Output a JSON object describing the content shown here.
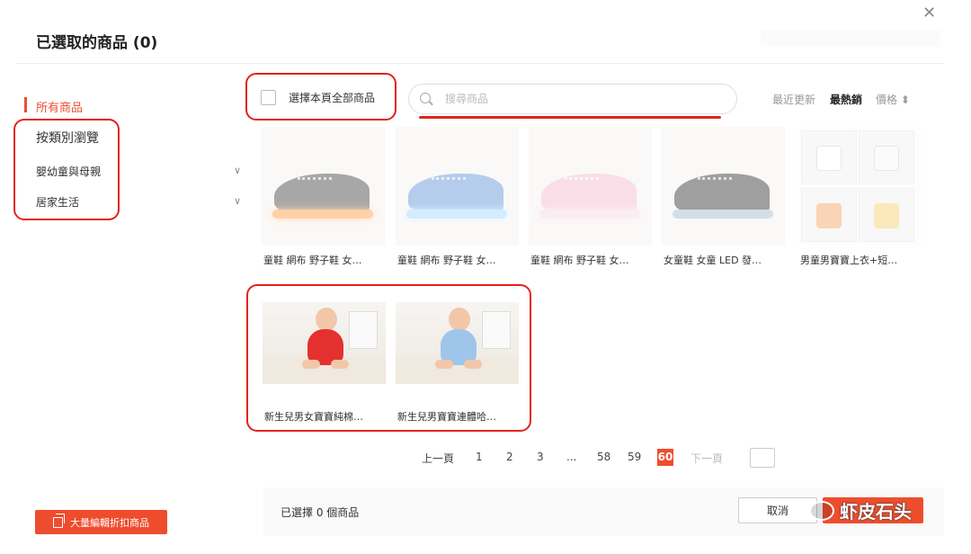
{
  "header": {
    "title": "已選取的商品 (0)",
    "close_icon": "close-icon"
  },
  "sidebar": {
    "items": [
      {
        "label": "所有商品",
        "active": true
      },
      {
        "label": "按類別瀏覽"
      },
      {
        "label": "嬰幼童與母親",
        "expandable": true
      },
      {
        "label": "居家生活",
        "expandable": true
      }
    ]
  },
  "toolbar": {
    "select_all_label": "選擇本頁全部商品",
    "search_placeholder": "搜尋商品",
    "search_value": "",
    "sort": {
      "recent": "最近更新",
      "hot": "最熱銷",
      "price": "價格 ⬍"
    }
  },
  "products": [
    {
      "name": "童鞋 網布 野子鞋 女…",
      "image": "orange-light-sneakers"
    },
    {
      "name": "童鞋 網布 野子鞋 女…",
      "image": "blue-light-sneakers"
    },
    {
      "name": "童鞋 網布 野子鞋 女…",
      "image": "pink-light-sneakers"
    },
    {
      "name": "女童鞋 女童 LED 發…",
      "image": "black-light-sneakers"
    },
    {
      "name": "男童男寶寶上衣+短…",
      "image": "kids-outfit-grid"
    },
    {
      "name": "新生兒男女寶寶純棉…",
      "image": "baby-red-bodysuit"
    },
    {
      "name": "新生兒男寶寶連體哈…",
      "image": "baby-blue-bodysuit"
    }
  ],
  "pagination": {
    "prev": "上一頁",
    "pages": [
      "1",
      "2",
      "3",
      "...",
      "58",
      "59"
    ],
    "current": "60",
    "next": "下一頁"
  },
  "footer": {
    "bulk_label": "大量編輯折扣商品",
    "selected_text": "已選擇 0 個商品",
    "cancel_label": "取消"
  },
  "watermark": {
    "text": "虾皮石头"
  },
  "colors": {
    "accent": "#ee4d2d",
    "annotation": "#e2231a"
  }
}
